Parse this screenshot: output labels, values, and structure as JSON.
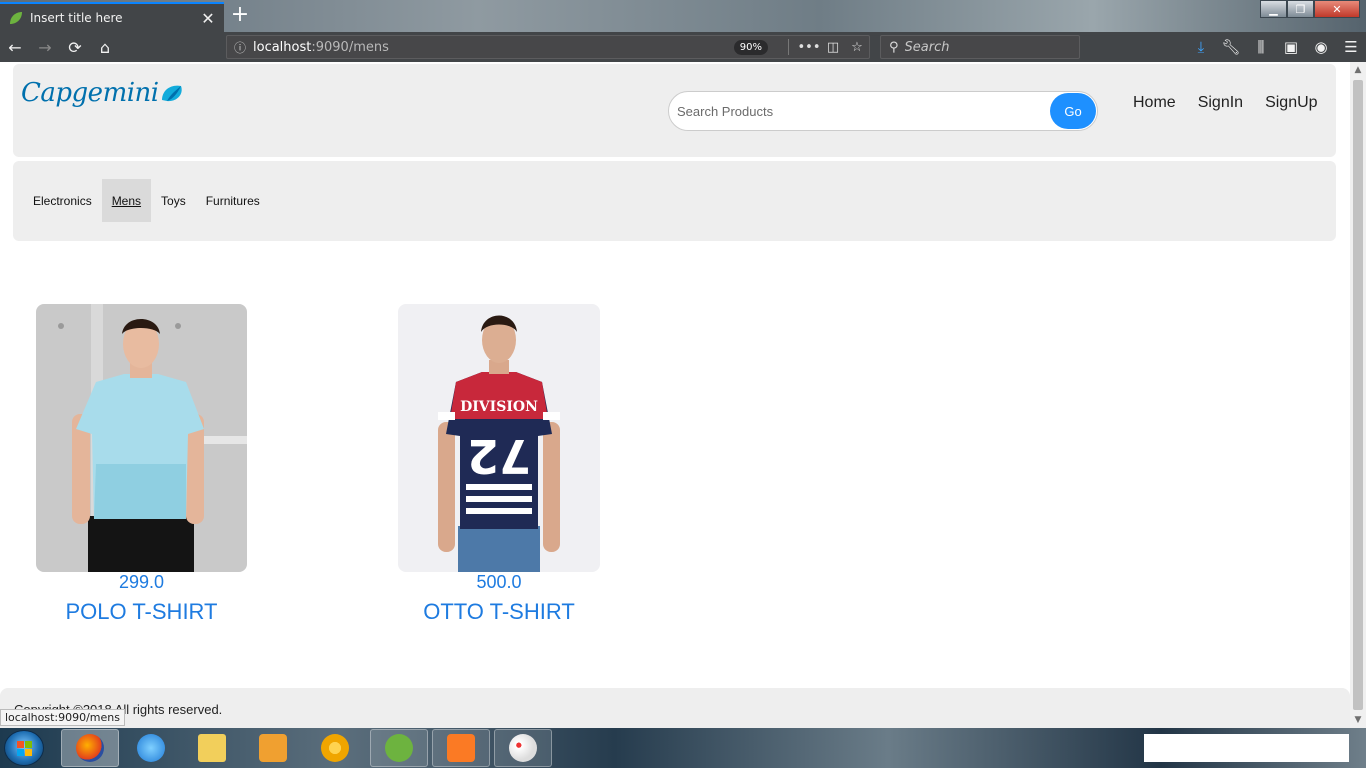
{
  "browser": {
    "tab_title": "Insert title here",
    "url_host": "localhost",
    "url_rest": ":9090/mens",
    "zoom": "90%",
    "search_placeholder": "Search",
    "status_url": "localhost:9090/mens"
  },
  "site": {
    "logo_text": "Capgemini",
    "search_placeholder": "Search Products",
    "go_label": "Go",
    "nav": [
      "Home",
      "SignIn",
      "SignUp"
    ],
    "categories": [
      "Electronics",
      "Mens",
      "Toys",
      "Furnitures"
    ],
    "active_category": "Mens"
  },
  "products": [
    {
      "price": "299.0",
      "name": "POLO T-SHIRT",
      "shirt_color": "#a8dceb"
    },
    {
      "price": "500.0",
      "name": "OTTO T-SHIRT",
      "shirt_color": "#1f2a55",
      "print_text": "DIVISION",
      "print_number": "72"
    }
  ],
  "footer": {
    "text": "Copyright ©2018 All rights reserved."
  },
  "colors": {
    "accent": "#1e90ff",
    "link": "#1e7be0",
    "logo": "#0070ad"
  }
}
